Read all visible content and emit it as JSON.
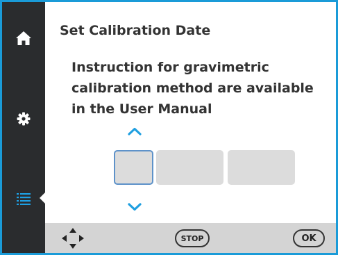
{
  "title": "Set Calibration Date",
  "instruction": "Instruction for gravimetric\ncalibration method are available\nin the User Manual",
  "date_fields": [
    "",
    "",
    ""
  ],
  "footer": {
    "stop_label": "STOP",
    "ok_label": "OK"
  },
  "colors": {
    "border": "#1a9bd8",
    "sidebar": "#2a2c2e",
    "active_icon": "#1ea0e3",
    "arrow": "#1f9fe0",
    "focus_outline": "#5e92c9",
    "footer": "#d4d4d4"
  },
  "icons": {
    "sidebar": [
      "home-icon",
      "gear-icon",
      "list-icon"
    ],
    "footer": [
      "nav-arrows-icon"
    ]
  }
}
